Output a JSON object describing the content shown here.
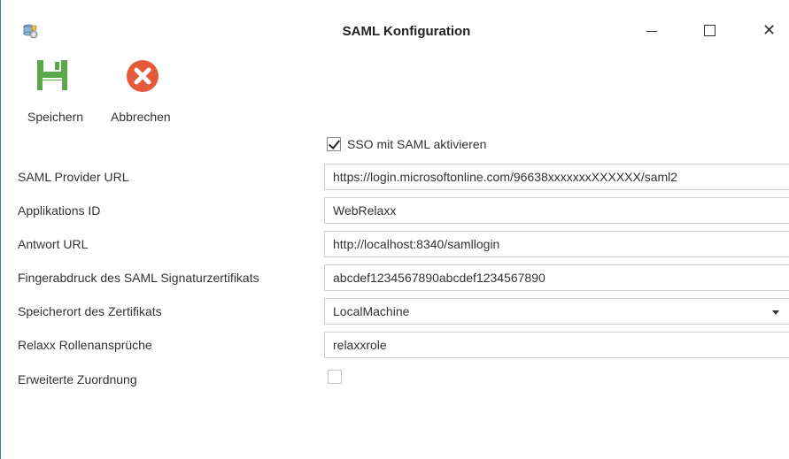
{
  "window": {
    "title": "SAML Konfiguration",
    "app_icon": "database-settings-icon",
    "controls": [
      "minimize-icon",
      "maximize-icon",
      "close-icon"
    ],
    "close_glyph": "✕"
  },
  "toolbar": {
    "save_label": "Speichern",
    "save_icon": "floppy-disk-icon",
    "cancel_label": "Abbrechen",
    "cancel_icon": "cancel-circle-icon"
  },
  "form": {
    "sso_checkbox_label": "SSO mit SAML aktivieren",
    "sso_checked": true,
    "fields": {
      "provider_url": {
        "label": "SAML Provider URL",
        "value": "https://login.microsoftonline.com/96638xxxxxxxXXXXXX/saml2"
      },
      "app_id": {
        "label": "Applikations ID",
        "value": "WebRelaxx"
      },
      "reply_url": {
        "label": "Antwort URL",
        "value": "http://localhost:8340/samllogin"
      },
      "thumbprint": {
        "label": "Fingerabdruck des SAML Signaturzertifikats",
        "value": "abcdef1234567890abcdef1234567890"
      },
      "cert_store": {
        "label": "Speicherort des Zertifikats",
        "value": "LocalMachine"
      },
      "role_claims": {
        "label": "Relaxx Rollenansprüche",
        "value": "relaxxrole"
      },
      "advanced_mapping": {
        "label": "Erweiterte Zuordnung",
        "checked": false
      }
    }
  },
  "colors": {
    "save_green": "#5ba84b",
    "cancel_red": "#e35b3a",
    "window_border": "#3c78b4",
    "field_border": "#cfcfcf"
  }
}
